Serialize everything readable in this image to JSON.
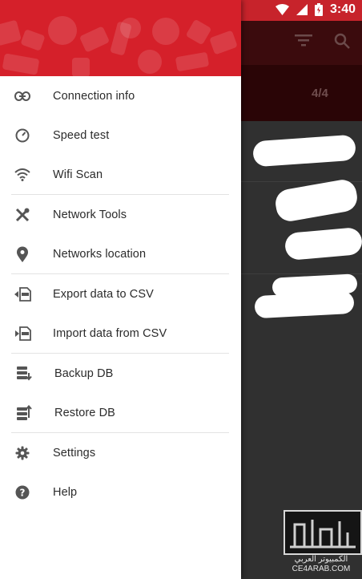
{
  "status_bar": {
    "time": "3:40"
  },
  "app_background": {
    "tab_count": "4/4"
  },
  "drawer": {
    "items": [
      {
        "label": "Connection info",
        "icon": "link-icon"
      },
      {
        "label": "Speed test",
        "icon": "speedometer-icon"
      },
      {
        "label": "Wifi Scan",
        "icon": "wifi-icon"
      },
      {
        "label": "Network Tools",
        "icon": "tools-icon"
      },
      {
        "label": "Networks location",
        "icon": "location-pin-icon"
      },
      {
        "label": "Export data to CSV",
        "icon": "csv-export-icon"
      },
      {
        "label": "Import data from CSV",
        "icon": "csv-import-icon"
      },
      {
        "label": "Backup DB",
        "icon": "database-backup-icon"
      },
      {
        "label": "Restore DB",
        "icon": "database-restore-icon"
      },
      {
        "label": "Settings",
        "icon": "gear-icon"
      },
      {
        "label": "Help",
        "icon": "help-icon"
      }
    ]
  },
  "watermark": {
    "text_ar": "الكمبيوتر العربي",
    "text_en": "CE4ARAB.COM"
  },
  "colors": {
    "brand_red": "#d5202a",
    "drawer_bg": "#ffffff",
    "scrim": "#2f2f2f"
  }
}
